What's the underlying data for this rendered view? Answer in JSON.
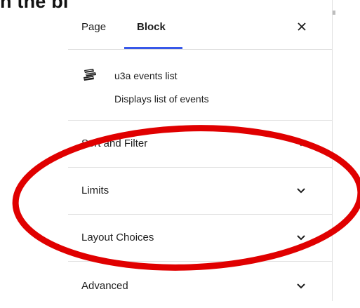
{
  "top_caption": "n the block settings on the right",
  "tabs": [
    {
      "label": "Page",
      "active": false
    },
    {
      "label": "Block",
      "active": true
    }
  ],
  "close_symbol": "✕",
  "block": {
    "icon": "book-stack-icon",
    "title": "u3a events list",
    "description": "Displays list of events"
  },
  "panels": [
    {
      "label": "Sort and Filter",
      "expanded": false
    },
    {
      "label": "Limits",
      "expanded": false
    },
    {
      "label": "Layout Choices",
      "expanded": false
    },
    {
      "label": "Advanced",
      "expanded": false
    }
  ],
  "colors": {
    "accent": "#3858e9",
    "annotation": "#e00000",
    "divider": "#e0e0e0"
  }
}
